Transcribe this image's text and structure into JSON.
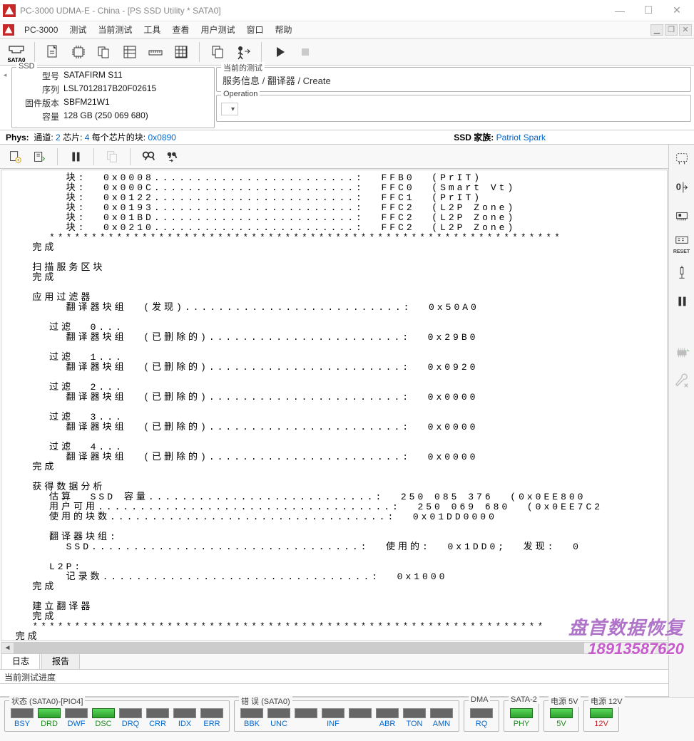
{
  "window": {
    "title": "PC-3000 UDMA-E - China - [PS SSD Utility * SATA0]"
  },
  "menubar": {
    "appLabel": "PC-3000",
    "items": [
      "测试",
      "当前测试",
      "工具",
      "查看",
      "用户测试",
      "窗口",
      "帮助"
    ]
  },
  "ssdPanel": {
    "legend": "SSD",
    "rows": [
      {
        "k": "型号",
        "v": "SATAFIRM   S11"
      },
      {
        "k": "序列",
        "v": "LSL7012817B20F02615"
      },
      {
        "k": "固件版本",
        "v": "SBFM21W1"
      },
      {
        "k": "容量",
        "v": "128 GB (250 069 680)"
      }
    ]
  },
  "currentTest": {
    "legend": "当前的测试",
    "value": "服务信息 / 翻译器 / Create"
  },
  "operation": {
    "legend": "Operation"
  },
  "phys": {
    "label": "Phys:",
    "channelsLabel": "通道:",
    "channels": "2",
    "chipsLabel": "芯片:",
    "chips": "4",
    "perChipLabel": "每个芯片的块:",
    "perChip": "0x0890",
    "familyLabel": "SSD 家族:",
    "family": "Patriot Spark"
  },
  "log": "       块:  0x0008........................:  FFB0  (PrIT)\n       块:  0x000C........................:  FFC0  (Smart Vt)\n       块:  0x0122........................:  FFC1  (PrIT)\n       块:  0x0193........................:  FFC2  (L2P Zone)\n       块:  0x01BD........................:  FFC2  (L2P Zone)\n       块:  0x0210........................:  FFC2  (L2P Zone)\n     *************************************************************\n   完成\n\n   扫描服务区块\n   完成\n\n   应用过滤器\n       翻译器块组  (发现)..........................:  0x50A0\n\n     过滤  0...\n       翻译器块组  (已删除的).......................:  0x29B0\n\n     过滤  1...\n       翻译器块组  (已删除的).......................:  0x0920\n\n     过滤  2...\n       翻译器块组  (已删除的).......................:  0x0000\n\n     过滤  3...\n       翻译器块组  (已删除的).......................:  0x0000\n\n     过滤  4...\n       翻译器块组  (已删除的).......................:  0x0000\n   完成\n\n   获得数据分析\n     估算  SSD 容量...........................:  250 085 376  (0x0EE800\n     用户可用...................................:  250 069 680  (0x0EE7C2\n     使用的块数.................................:  0x01DD0000\n\n     翻译器块组:\n       SSD................................:  使用的:  0x1DD0;  发现:  0\n\n     L2P:\n       记录数................................:  0x1000\n   完成\n\n   建立翻译器\n   完成\n   *************************************************************\n 完成\n *************************************************************\n测试完成",
  "tabs": {
    "log": "日志",
    "report": "报告"
  },
  "progressLabel": "当前测试进度",
  "statusGroups": {
    "state": {
      "legend": "状态 (SATA0)-[PIO4]",
      "leds": [
        {
          "lbl": "BSY",
          "on": false,
          "cls": ""
        },
        {
          "lbl": "DRD",
          "on": true,
          "cls": "green"
        },
        {
          "lbl": "DWF",
          "on": false,
          "cls": ""
        },
        {
          "lbl": "DSC",
          "on": true,
          "cls": "green"
        },
        {
          "lbl": "DRQ",
          "on": false,
          "cls": ""
        },
        {
          "lbl": "CRR",
          "on": false,
          "cls": ""
        },
        {
          "lbl": "IDX",
          "on": false,
          "cls": ""
        },
        {
          "lbl": "ERR",
          "on": false,
          "cls": ""
        }
      ]
    },
    "error": {
      "legend": "错 误 (SATA0)",
      "leds": [
        {
          "lbl": "BBK",
          "on": false,
          "cls": ""
        },
        {
          "lbl": "UNC",
          "on": false,
          "cls": ""
        },
        {
          "lbl": "",
          "on": false,
          "cls": ""
        },
        {
          "lbl": "INF",
          "on": false,
          "cls": ""
        },
        {
          "lbl": "",
          "on": false,
          "cls": ""
        },
        {
          "lbl": "ABR",
          "on": false,
          "cls": ""
        },
        {
          "lbl": "TON",
          "on": false,
          "cls": ""
        },
        {
          "lbl": "AMN",
          "on": false,
          "cls": ""
        }
      ]
    },
    "dma": {
      "legend": "DMA",
      "leds": [
        {
          "lbl": "RQ",
          "on": false,
          "cls": ""
        }
      ]
    },
    "sata2": {
      "legend": "SATA-2",
      "leds": [
        {
          "lbl": "PHY",
          "on": true,
          "cls": "green"
        }
      ]
    },
    "pwr5": {
      "legend": "电源 5V",
      "leds": [
        {
          "lbl": "5V",
          "on": true,
          "cls": "green"
        }
      ]
    },
    "pwr12": {
      "legend": "电源 12V",
      "leds": [
        {
          "lbl": "12V",
          "on": true,
          "cls": "red"
        }
      ]
    }
  },
  "watermark": {
    "line1": "盘首数据恢复",
    "line2": "18913587620"
  }
}
